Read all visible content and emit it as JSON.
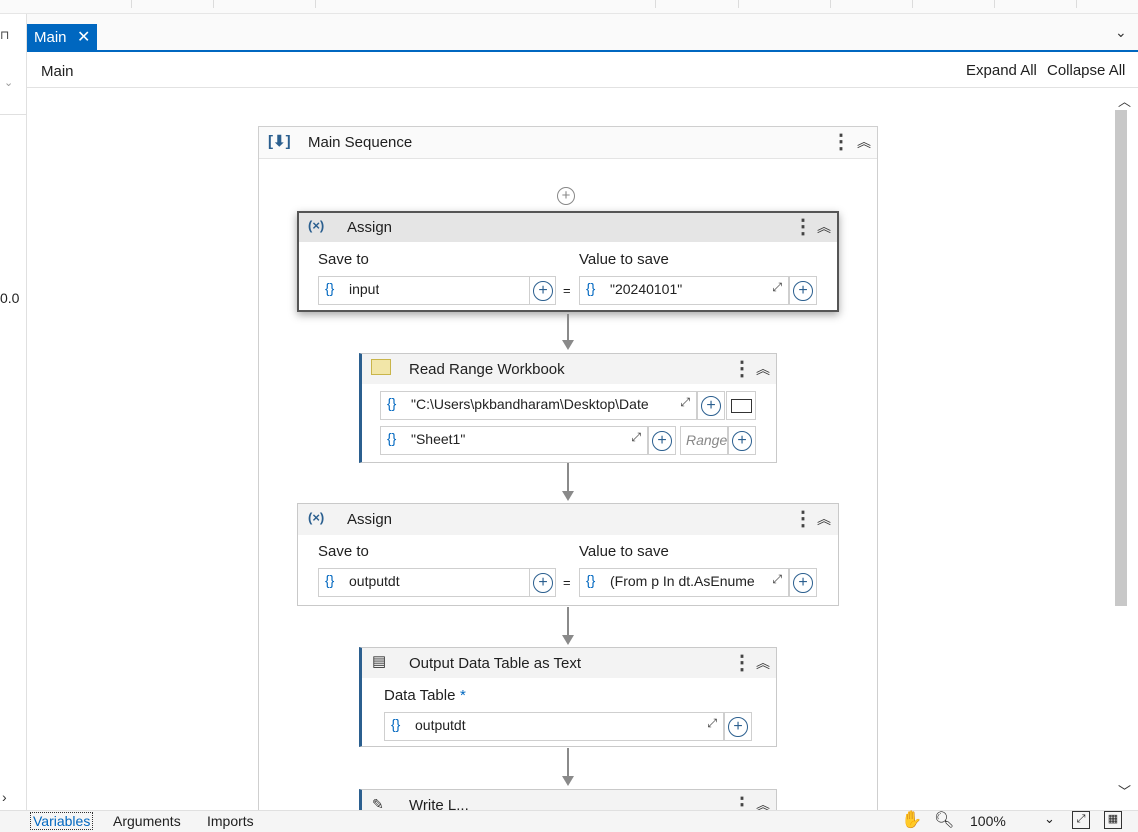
{
  "tab": {
    "label": "Main"
  },
  "breadcrumb": "Main",
  "toolbar": {
    "expand_all": "Expand All",
    "collapse_all": "Collapse All"
  },
  "left_panel": {
    "value": "0.0"
  },
  "sequence": {
    "title": "Main Sequence"
  },
  "assign1": {
    "title": "Assign",
    "save_to_label": "Save to",
    "value_label": "Value to save",
    "save_to": "input",
    "value": "\"20240101\"",
    "equals": "="
  },
  "read_range": {
    "title": "Read Range Workbook",
    "path": "\"C:\\Users\\pkbandharam\\Desktop\\Date",
    "sheet": "\"Sheet1\"",
    "range_placeholder": "Range"
  },
  "assign2": {
    "title": "Assign",
    "save_to_label": "Save to",
    "value_label": "Value to save",
    "save_to": "outputdt",
    "value": "(From p In dt.AsEnume",
    "equals": "="
  },
  "output_dt": {
    "title": "Output Data Table as Text",
    "label": "Data Table",
    "required_mark": "*",
    "value": "outputdt"
  },
  "write_partial": {
    "title": "Write L..."
  },
  "status": {
    "tabs": [
      "Variables",
      "Arguments",
      "Imports"
    ],
    "zoom": "100%"
  },
  "icons": {
    "brace": "{}",
    "plus": "+",
    "kebab": "⋮",
    "collapse": "︽",
    "expand": "⤢"
  }
}
